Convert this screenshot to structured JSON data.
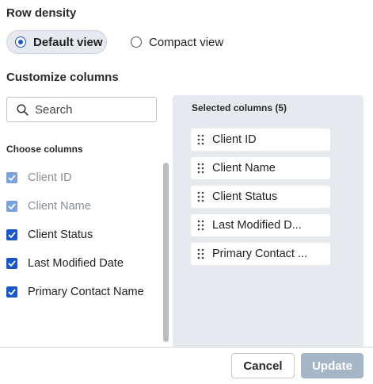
{
  "row_density": {
    "title": "Row density",
    "options": [
      {
        "label": "Default view",
        "selected": true
      },
      {
        "label": "Compact view",
        "selected": false
      }
    ]
  },
  "customize": {
    "title": "Customize columns",
    "search": {
      "placeholder": "Search",
      "value": "",
      "icon": "search-icon"
    },
    "choose_title": "Choose columns",
    "columns": [
      {
        "label": "Client ID",
        "checked": true,
        "disabled": true
      },
      {
        "label": "Client Name",
        "checked": true,
        "disabled": true
      },
      {
        "label": "Client Status",
        "checked": true,
        "disabled": false
      },
      {
        "label": "Last Modified Date",
        "checked": true,
        "disabled": false
      },
      {
        "label": "Primary Contact Name",
        "checked": true,
        "disabled": false
      }
    ],
    "selected_title": "Selected columns (5)",
    "selected": [
      {
        "label": "Client ID"
      },
      {
        "label": "Client Name"
      },
      {
        "label": "Client Status"
      },
      {
        "label": "Last Modified D..."
      },
      {
        "label": "Primary Contact ..."
      }
    ]
  },
  "footer": {
    "cancel_label": "Cancel",
    "update_label": "Update"
  },
  "colors": {
    "accent": "#1a56c4",
    "accent_disabled": "#7aa0dd",
    "panel_bg": "#e6e9ed",
    "update_disabled": "#a7b6c7"
  }
}
